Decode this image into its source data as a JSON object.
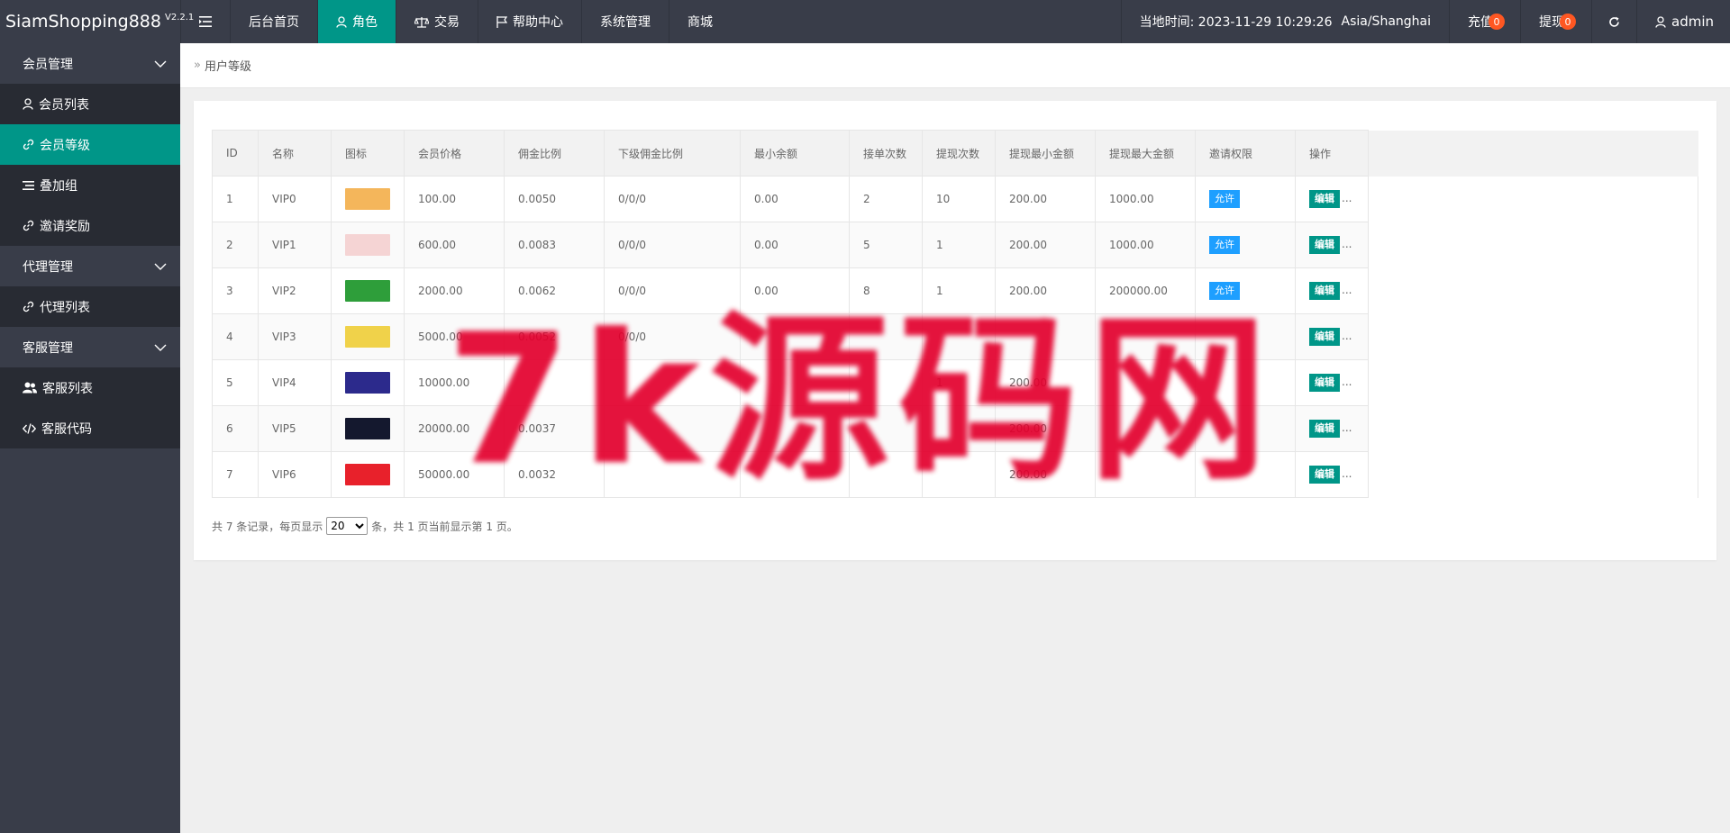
{
  "app": {
    "title": "SiamShopping888",
    "version": "V2.2.1"
  },
  "topnav": {
    "items": [
      {
        "label": "后台首页"
      },
      {
        "label": "角色"
      },
      {
        "label": "交易"
      },
      {
        "label": "帮助中心"
      },
      {
        "label": "系统管理"
      },
      {
        "label": "商城"
      }
    ],
    "time_label": "当地时间: 2023-11-29 10:29:26",
    "timezone": "Asia/Shanghai",
    "recharge_label": "充值",
    "recharge_count": "0",
    "withdraw_label": "提现",
    "withdraw_count": "0",
    "user": "admin"
  },
  "sidebar": {
    "groups": [
      {
        "label": "会员管理",
        "items": [
          {
            "label": "会员列表",
            "icon": "user-icon"
          },
          {
            "label": "会员等级",
            "icon": "link-icon"
          },
          {
            "label": "叠加组",
            "icon": "list-icon"
          },
          {
            "label": "邀请奖励",
            "icon": "link-icon"
          }
        ]
      },
      {
        "label": "代理管理",
        "items": [
          {
            "label": "代理列表",
            "icon": "link-icon"
          }
        ]
      },
      {
        "label": "客服管理",
        "items": [
          {
            "label": "客服列表",
            "icon": "users-icon"
          },
          {
            "label": "客服代码",
            "icon": "code-icon"
          }
        ]
      }
    ]
  },
  "breadcrumb": {
    "current": "用户等级"
  },
  "table": {
    "headers": [
      "ID",
      "名称",
      "图标",
      "会员价格",
      "佣金比例",
      "下级佣金比例",
      "最小余额",
      "接单次数",
      "提现次数",
      "提现最小金额",
      "提现最大金额",
      "邀请权限",
      "操作"
    ],
    "rows": [
      [
        "1",
        "VIP0",
        "",
        "100.00",
        "0.0050",
        "0/0/0",
        "0.00",
        "2",
        "10",
        "200.00",
        "1000.00",
        "允许",
        "编辑"
      ],
      [
        "2",
        "VIP1",
        "",
        "600.00",
        "0.0083",
        "0/0/0",
        "0.00",
        "5",
        "1",
        "200.00",
        "1000.00",
        "允许",
        "编辑"
      ],
      [
        "3",
        "VIP2",
        "",
        "2000.00",
        "0.0062",
        "0/0/0",
        "0.00",
        "8",
        "1",
        "200.00",
        "200000.00",
        "允许",
        "编辑"
      ],
      [
        "4",
        "VIP3",
        "",
        "5000.00",
        "0.0052",
        "0/0/0",
        "",
        "",
        "",
        "",
        "",
        "",
        "编辑"
      ],
      [
        "5",
        "VIP4",
        "",
        "10000.00",
        "",
        "",
        "",
        "",
        "1",
        "200.00",
        "",
        "",
        "编辑"
      ],
      [
        "6",
        "VIP5",
        "",
        "20000.00",
        "0.0037",
        "",
        "",
        "",
        "",
        "200.00",
        "",
        "",
        "编辑"
      ],
      [
        "7",
        "VIP6",
        "",
        "50000.00",
        "0.0032",
        "",
        "",
        "",
        "",
        "200.00",
        "",
        "",
        "编辑"
      ]
    ],
    "thumb_colors": [
      "#f4b65b",
      "#f5d4d4",
      "#2e9e3a",
      "#f0d24a",
      "#2c2a8c",
      "#14182e",
      "#e8212b"
    ],
    "more_label": "..."
  },
  "pager": {
    "prefix": "共 7 条记录，每页显示",
    "page_size": "20",
    "page_size_options": [
      "10",
      "20",
      "50"
    ],
    "suffix": "条，共 1 页当前显示第 1 页。"
  },
  "watermark": {
    "text": "7k源码网"
  }
}
